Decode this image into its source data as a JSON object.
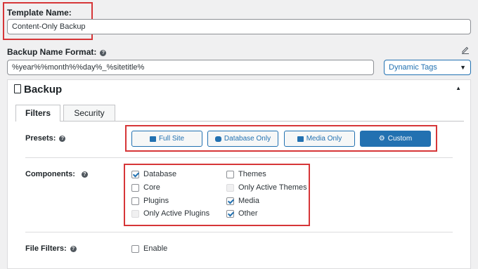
{
  "template_name": {
    "label": "Template Name:",
    "value": "Content-Only Backup"
  },
  "backup_name_format": {
    "label": "Backup Name Format:",
    "value": "%year%%month%%day%_%sitetitle%",
    "dynamic_tags": "Dynamic Tags"
  },
  "backup_section": {
    "title": "Backup",
    "tabs": [
      "Filters",
      "Security"
    ],
    "presets": {
      "label": "Presets:",
      "buttons": [
        {
          "label": "Full Site",
          "icon": "checkbox-icon"
        },
        {
          "label": "Database Only",
          "icon": "database-icon"
        },
        {
          "label": "Media Only",
          "icon": "image-icon"
        },
        {
          "label": "Custom",
          "icon": "gear-icon",
          "active": true
        }
      ]
    },
    "components": {
      "label": "Components:",
      "items": [
        {
          "label": "Database",
          "checked": true,
          "disabled": false
        },
        {
          "label": "Core",
          "checked": false,
          "disabled": false
        },
        {
          "label": "Plugins",
          "checked": false,
          "disabled": false
        },
        {
          "label": "Only Active Plugins",
          "checked": false,
          "disabled": true
        },
        {
          "label": "Themes",
          "checked": false,
          "disabled": false
        },
        {
          "label": "Only Active Themes",
          "checked": false,
          "disabled": true
        },
        {
          "label": "Media",
          "checked": true,
          "disabled": false
        },
        {
          "label": "Other",
          "checked": true,
          "disabled": false
        }
      ]
    },
    "file_filters": {
      "label": "File Filters:",
      "enable_label": "Enable",
      "checked": false
    }
  },
  "colors": {
    "accent": "#2271b1",
    "highlight": "#d63638"
  }
}
